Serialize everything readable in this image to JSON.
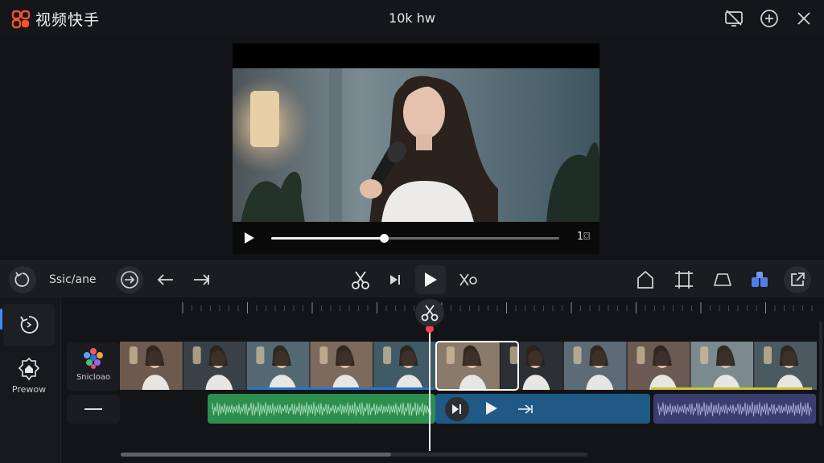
{
  "app": {
    "brand_name": "视频快手",
    "window_title": "10k hw",
    "brand_color": "#f2532e"
  },
  "window_controls": [
    {
      "icon": "screen-off-icon"
    },
    {
      "icon": "add-circle-icon"
    },
    {
      "icon": "close-icon"
    }
  ],
  "player": {
    "time_label": "1⌼",
    "progress": 0.39
  },
  "toolbar": {
    "undo_label": "Ssic/ane",
    "tools": [
      "undo-icon",
      "navigate-icon",
      "back-arrow-icon",
      "forward-arrow-icon",
      "scissors-icon",
      "skip-icon",
      "play-icon",
      "split-icon",
      "shape-icon",
      "crop-icon",
      "fade-icon",
      "layers-icon",
      "export-icon"
    ]
  },
  "rail": {
    "items": [
      {
        "label": "",
        "icon": "timer-refresh-icon",
        "active": true
      },
      {
        "label": "Prewow",
        "icon": "home-badge-icon",
        "active": false
      }
    ]
  },
  "timeline": {
    "track_label": "Snicloao",
    "audio_track_icon": "minus-icon",
    "accent_colors": {
      "audio_green": "#2d8f4e",
      "audio_blue": "#1f5a86",
      "audio_purple": "#3a3d70",
      "playhead": "#ff3b55",
      "highlight_blue": "#2a73c9",
      "highlight_yellow": "#c9c436"
    },
    "scroll_fraction": 0.58
  }
}
